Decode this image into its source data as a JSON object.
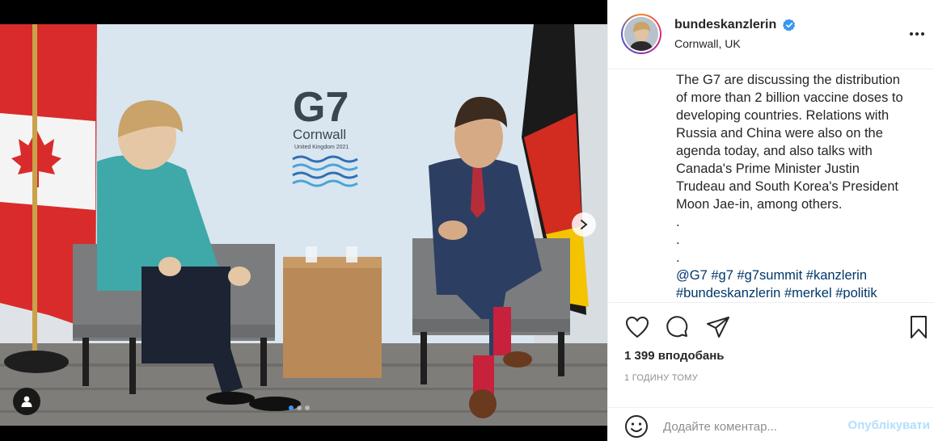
{
  "post": {
    "username": "bundeskanzlerin",
    "location": "Cornwall, UK",
    "caption_lines": [
      "The G7 are discussing the distribution",
      "of more than 2 billion vaccine doses to",
      "developing countries. Relations with",
      "Russia and China were also on the",
      "agenda today, and also talks with",
      "Canada's Prime Minister Justin",
      "Trudeau and South Korea's President",
      "Moon Jae-in, among others.",
      ".",
      ".",
      "."
    ],
    "hashtags_line1": [
      "@G7",
      "#g7",
      "#g7summit",
      "#kanzlerin"
    ],
    "hashtags_line2": [
      "#bundeskanzlerin",
      "#merkel",
      "#politik"
    ],
    "likes": "1 399 вподобань",
    "time": "1 ГОДИНУ ТОМУ"
  },
  "comment": {
    "placeholder": "Додайте коментар...",
    "post_label": "Опублікувати"
  },
  "photo": {
    "sign_g7": "G7",
    "sign_cornwall": "Cornwall",
    "sign_sub": "United Kingdom 2021"
  },
  "icons": {
    "like": "heart-icon",
    "comment": "comment-icon",
    "share": "paper-plane-icon",
    "save": "bookmark-icon",
    "more": "more-horizontal-icon",
    "next": "chevron-right-icon",
    "tag": "user-tag-icon",
    "emoji": "smiley-icon",
    "verified": "verified-badge-icon"
  },
  "colors": {
    "verified": "#3897f0",
    "link": "#00376b",
    "post_disabled": "#b2dffc",
    "muted": "#8e8e8e"
  },
  "carousel": {
    "total_slides": 3,
    "active_slide": 1
  }
}
